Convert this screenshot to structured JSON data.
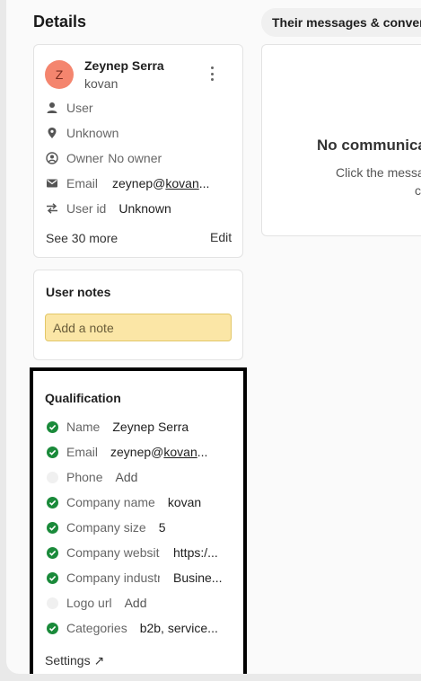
{
  "details": {
    "title": "Details",
    "profile": {
      "avatar_initial": "Z",
      "name": "Zeynep Serra",
      "company": "kovan",
      "properties": [
        {
          "icon": "person-icon",
          "label": "User",
          "value": ""
        },
        {
          "icon": "location-pin-icon",
          "label": "Unknown",
          "value": ""
        },
        {
          "icon": "owner-icon",
          "label": "Owner",
          "value": "No owner"
        },
        {
          "icon": "mail-icon",
          "label": "Email",
          "value_prefix": "zeynep@",
          "value_link": "kovan",
          "value_suffix": "..."
        },
        {
          "icon": "swap-icon",
          "label": "User id",
          "value": "Unknown"
        }
      ],
      "see_more": "See 30 more",
      "edit": "Edit"
    },
    "notes": {
      "title": "User notes",
      "placeholder": "Add a note"
    },
    "qualification": {
      "title": "Qualification",
      "rows": [
        {
          "label": "Name",
          "value": "Zeynep Serra",
          "status": "complete"
        },
        {
          "label": "Email",
          "value_prefix": "zeynep@",
          "value_link": "kovan",
          "value_suffix": "...",
          "status": "complete"
        },
        {
          "label": "Phone",
          "add": "Add",
          "status": "empty"
        },
        {
          "label": "Company name",
          "value": "kovan",
          "status": "complete"
        },
        {
          "label": "Company size",
          "value": "5",
          "status": "complete"
        },
        {
          "label": "Company website",
          "value": "https:/...",
          "status": "complete"
        },
        {
          "label": "Company industry",
          "value": "Busine...",
          "status": "complete"
        },
        {
          "label": "Logo url",
          "add": "Add",
          "status": "empty"
        },
        {
          "label": "Categories",
          "value": "b2b, service...",
          "status": "complete"
        }
      ],
      "settings": "Settings ↗"
    }
  },
  "right_panel": {
    "tab_label": "Their messages & conversations",
    "empty_title": "No communications",
    "empty_sub_line1": "Click the message",
    "empty_sub_line2": "c"
  },
  "colors": {
    "accent_check": "#1a8a3a",
    "avatar_bg": "#f4856e",
    "note_bg": "#fbe6a6",
    "highlight_border": "#000000"
  }
}
